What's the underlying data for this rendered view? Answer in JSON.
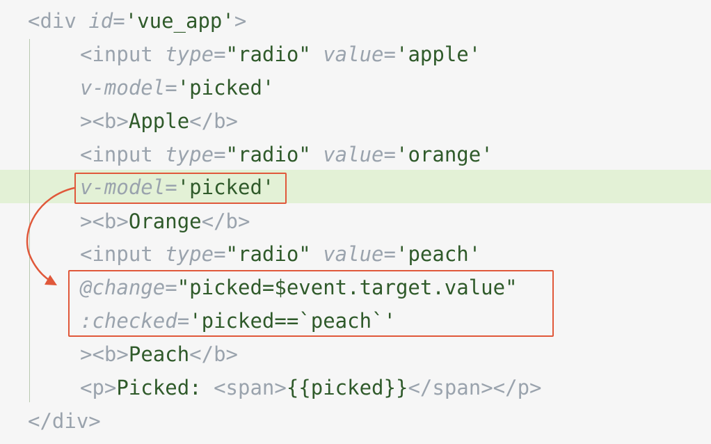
{
  "code": {
    "line1": {
      "open": "<div ",
      "attr": "id",
      "eq": "=",
      "val": "'vue_app'",
      "close": ">"
    },
    "line2": {
      "open": "<input ",
      "attr1": "type",
      "eq1": "=",
      "val1": "\"radio\"",
      "space": " ",
      "attr2": "value",
      "eq2": "=",
      "val2": "'apple'"
    },
    "line3": {
      "attr": "v-model",
      "eq": "=",
      "val": "'picked'"
    },
    "line4": {
      "gt": ">",
      "btag": "<b>",
      "text": "Apple",
      "bclose": "</b>"
    },
    "line5": {
      "open": "<input ",
      "attr1": "type",
      "eq1": "=",
      "val1": "\"radio\"",
      "space": " ",
      "attr2": "value",
      "eq2": "=",
      "val2": "'orange'"
    },
    "line6": {
      "attr": "v-model",
      "eq": "=",
      "val": "'picked'"
    },
    "line7": {
      "gt": ">",
      "btag": "<b>",
      "text": "Orange",
      "bclose": "</b>"
    },
    "line8": {
      "open": "<input ",
      "attr1": "type",
      "eq1": "=",
      "val1": "\"radio\"",
      "space": " ",
      "attr2": "value",
      "eq2": "=",
      "val2": "'peach'"
    },
    "line9": {
      "attr": "@change",
      "eq": "=",
      "val": "\"picked=$event.target.value\""
    },
    "line10": {
      "attr": ":checked",
      "eq": "=",
      "val": "'picked==`peach`'"
    },
    "line11": {
      "gt": ">",
      "btag": "<b>",
      "text": "Peach",
      "bclose": "</b>"
    },
    "line12": {
      "popen": "<p>",
      "text": "Picked: ",
      "spanopen": "<span>",
      "expr": "{{picked}}",
      "spanclose": "</span>",
      "pclose": "</p>"
    },
    "line13": {
      "close": "</div>"
    }
  },
  "colors": {
    "annotation": "#e0583a",
    "highlight": "#e3f1d6",
    "string": "#2f5a2a",
    "tag": "#9aa3ad"
  }
}
